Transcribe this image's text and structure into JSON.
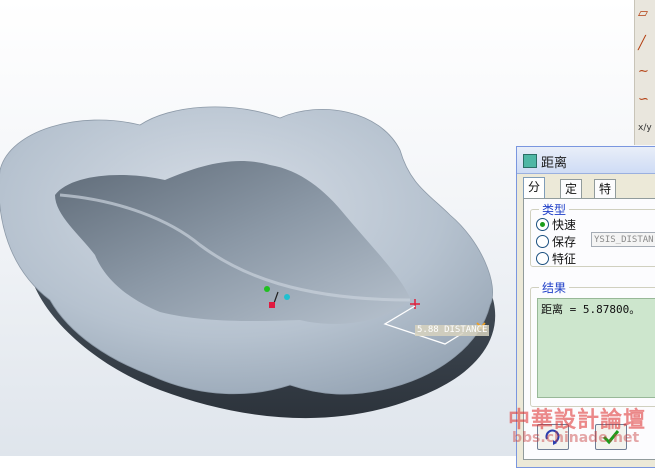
{
  "dialog": {
    "title": "距离",
    "tabs": [
      "分析",
      "定义",
      "特征"
    ],
    "active_tab": "分析",
    "type_group_label": "类型",
    "type_options": [
      "快速",
      "保存",
      "特征"
    ],
    "selected_type": "快速",
    "save_name_value": "YSIS_DISTAN",
    "result_group_label": "结果",
    "result_text": "距离 = 5.87800。"
  },
  "viewport": {
    "dimension_label": "5.88  DISTANCE"
  },
  "watermark": {
    "logo_text": "中華設計論壇",
    "url_text": "bbs.chinade.net"
  },
  "icons": {
    "toolbar": [
      "parallelogram-icon",
      "dashed-line-icon",
      "curve-icon",
      "spline-icon",
      "axis-xyz-icon"
    ],
    "dialog_title": "analysis-icon",
    "buttons": [
      "repeat-icon",
      "ok-check-icon"
    ]
  },
  "colors": {
    "surface": "#a9b7c5",
    "accent_green_radio": "#1a9d1a",
    "result_bg": "#cde6cd",
    "group_label": "#1f3fc8",
    "datum_point": "#e0203a"
  }
}
